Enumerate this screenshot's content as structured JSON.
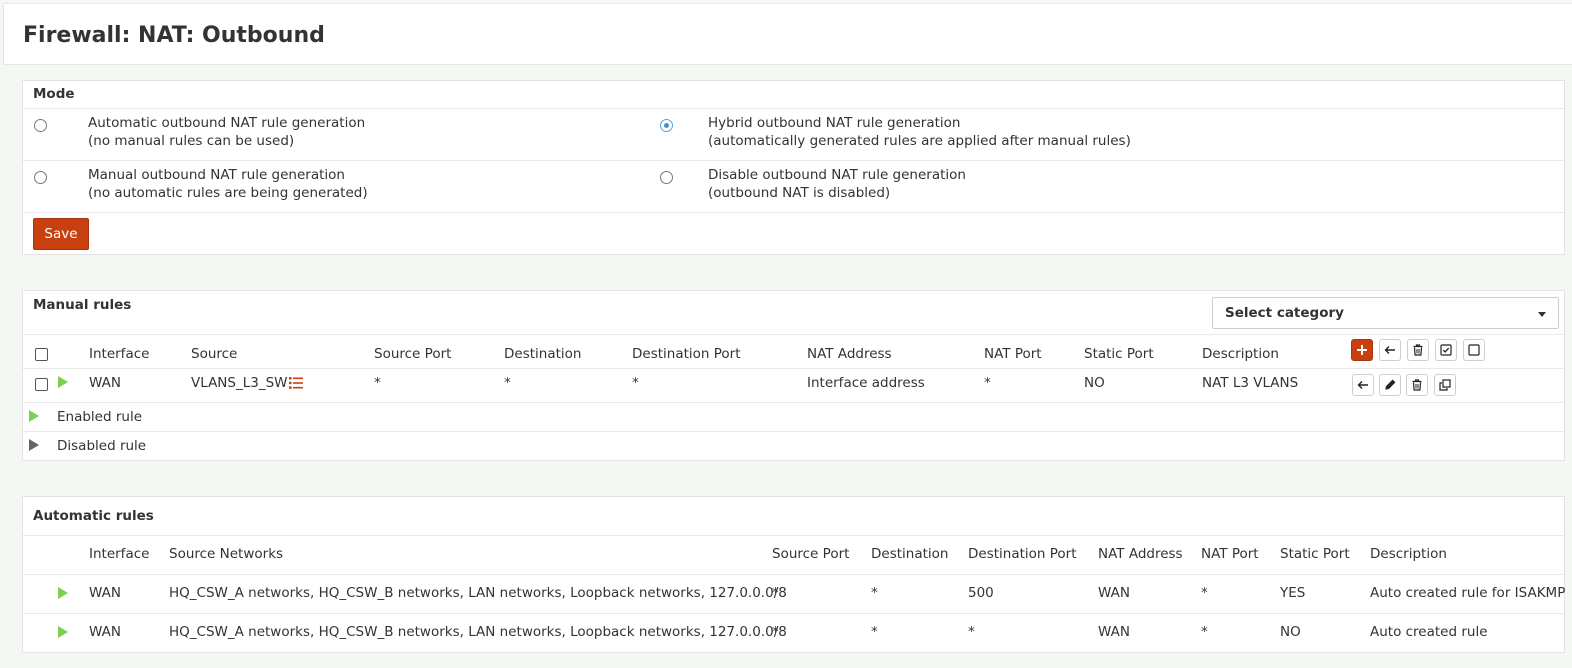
{
  "page": {
    "title": "Firewall: NAT: Outbound"
  },
  "mode": {
    "title": "Mode",
    "options": [
      {
        "line1": "Automatic outbound NAT rule generation",
        "line2": "(no manual rules can be used)",
        "selected": false
      },
      {
        "line1": "Hybrid outbound NAT rule generation",
        "line2": "(automatically generated rules are applied after manual rules)",
        "selected": true
      },
      {
        "line1": "Manual outbound NAT rule generation",
        "line2": "(no automatic rules are being generated)",
        "selected": false
      },
      {
        "line1": "Disable outbound NAT rule generation",
        "line2": "(outbound NAT is disabled)",
        "selected": false
      }
    ],
    "save_label": "Save"
  },
  "manual": {
    "title": "Manual rules",
    "category_placeholder": "Select category",
    "headers": [
      "Interface",
      "Source",
      "Source Port",
      "Destination",
      "Destination Port",
      "NAT Address",
      "NAT Port",
      "Static Port",
      "Description"
    ],
    "rows": [
      {
        "interface": "WAN",
        "source": "VLANS_L3_SW",
        "source_port": "*",
        "destination": "*",
        "destination_port": "*",
        "nat_address": "Interface address",
        "nat_port": "*",
        "static_port": "NO",
        "description": "NAT L3 VLANS",
        "enabled": true
      }
    ],
    "legend": {
      "enabled": "Enabled rule",
      "disabled": "Disabled rule"
    },
    "colors": {
      "enabled": "#7ccf4f",
      "disabled": "#666666",
      "accent": "#c8400f"
    }
  },
  "automatic": {
    "title": "Automatic rules",
    "headers": [
      "Interface",
      "Source Networks",
      "Source Port",
      "Destination",
      "Destination Port",
      "NAT Address",
      "NAT Port",
      "Static Port",
      "Description"
    ],
    "rows": [
      {
        "interface": "WAN",
        "source_networks": "HQ_CSW_A networks, HQ_CSW_B networks, LAN networks, Loopback networks, 127.0.0.0/8",
        "source_port": "*",
        "destination": "*",
        "destination_port": "500",
        "nat_address": "WAN",
        "nat_port": "*",
        "static_port": "YES",
        "description": "Auto created rule for ISAKMP"
      },
      {
        "interface": "WAN",
        "source_networks": "HQ_CSW_A networks, HQ_CSW_B networks, LAN networks, Loopback networks, 127.0.0.0/8",
        "source_port": "*",
        "destination": "*",
        "destination_port": "*",
        "nat_address": "WAN",
        "nat_port": "*",
        "static_port": "NO",
        "description": "Auto created rule"
      }
    ]
  }
}
